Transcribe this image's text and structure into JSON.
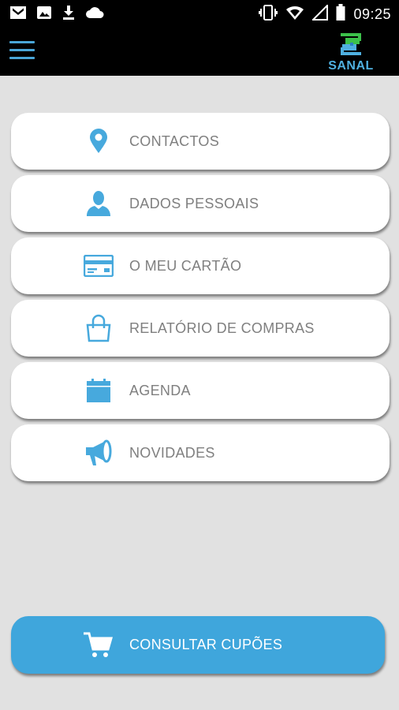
{
  "status_bar": {
    "time": "09:25",
    "left_icons": [
      "gmail-icon",
      "image-icon",
      "download-icon",
      "cloud-icon"
    ],
    "right_icons": [
      "vibrate-icon",
      "wifi-icon",
      "signal-icon",
      "battery-icon"
    ]
  },
  "app_bar": {
    "logo_text": "SANAL",
    "menu_icon": "hamburger-icon"
  },
  "menu": {
    "items": [
      {
        "label": "CONTACTOS",
        "icon": "location-pin-icon"
      },
      {
        "label": "DADOS PESSOAIS",
        "icon": "person-icon"
      },
      {
        "label": "O MEU CARTÃO",
        "icon": "card-icon"
      },
      {
        "label": "RELATÓRIO DE COMPRAS",
        "icon": "shopping-bag-icon"
      },
      {
        "label": "AGENDA",
        "icon": "calendar-icon"
      },
      {
        "label": "NOVIDADES",
        "icon": "megaphone-icon"
      }
    ]
  },
  "cta": {
    "label": "CONSULTAR CUPÕES",
    "icon": "cart-icon"
  },
  "colors": {
    "accent": "#3fa6dc",
    "icon_blue": "#47a9dd",
    "background": "#e1e1e1",
    "bar": "#000000",
    "label_gray": "#7f7f7f",
    "logo_green": "#3cc14a"
  }
}
